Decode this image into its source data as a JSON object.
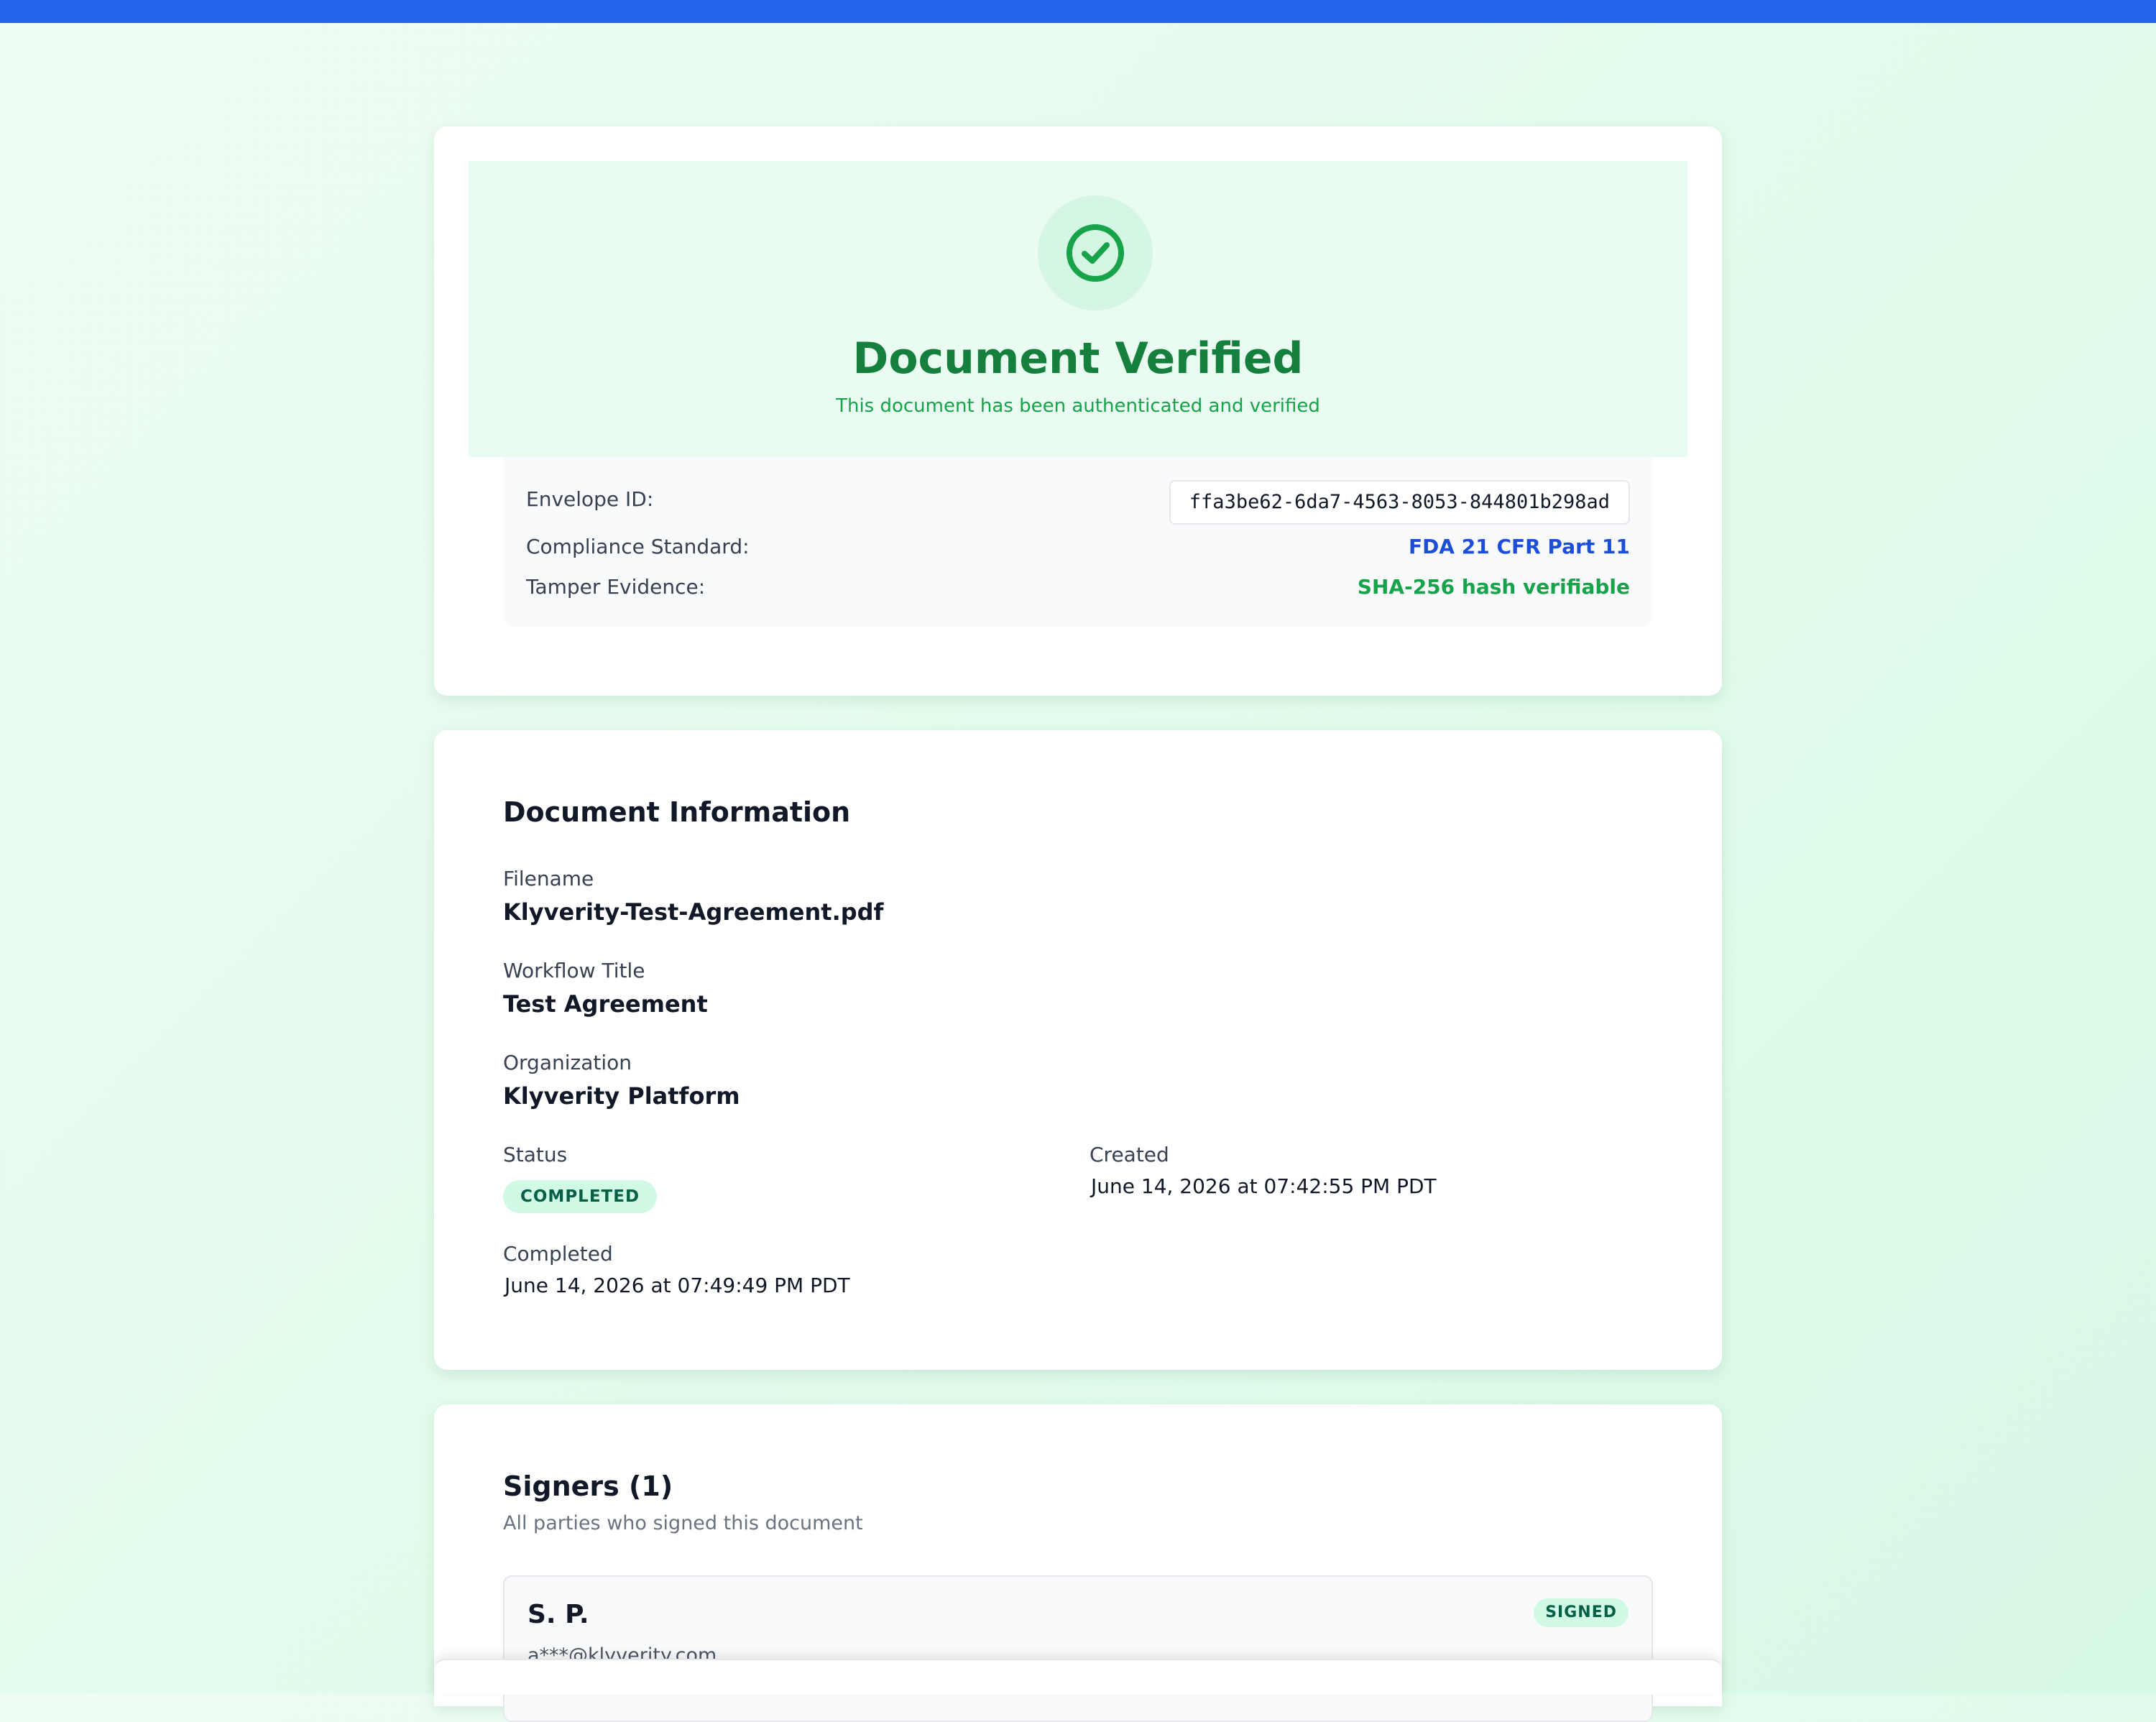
{
  "colors": {
    "top_bar": "#2563eb",
    "verified_green": "#15803d",
    "link_blue": "#1d4ed8",
    "badge_bg": "#d1fae5"
  },
  "verification": {
    "icon": "check-circle-icon",
    "title": "Document Verified",
    "subtitle": "This document has been authenticated and verified",
    "envelope_label": "Envelope ID:",
    "envelope_id": "ffa3be62-6da7-4563-8053-844801b298ad",
    "compliance_label": "Compliance Standard:",
    "compliance_value": "FDA 21 CFR Part 11",
    "tamper_label": "Tamper Evidence:",
    "tamper_value": "SHA-256 hash verifiable"
  },
  "document_info": {
    "heading": "Document Information",
    "filename_label": "Filename",
    "filename": "Klyverity-Test-Agreement.pdf",
    "workflow_label": "Workflow Title",
    "workflow_title": "Test Agreement",
    "organization_label": "Organization",
    "organization": "Klyverity Platform",
    "status_label": "Status",
    "status": "COMPLETED",
    "created_label": "Created",
    "created": "June 14, 2026 at 07:42:55 PM PDT",
    "completed_label": "Completed",
    "completed": "June 14, 2026 at 07:49:49 PM PDT"
  },
  "signers": {
    "heading": "Signers (1)",
    "subtitle": "All parties who signed this document",
    "list": [
      {
        "name": "S. P.",
        "email": "a***@klyverity.com",
        "status": "SIGNED"
      }
    ]
  }
}
